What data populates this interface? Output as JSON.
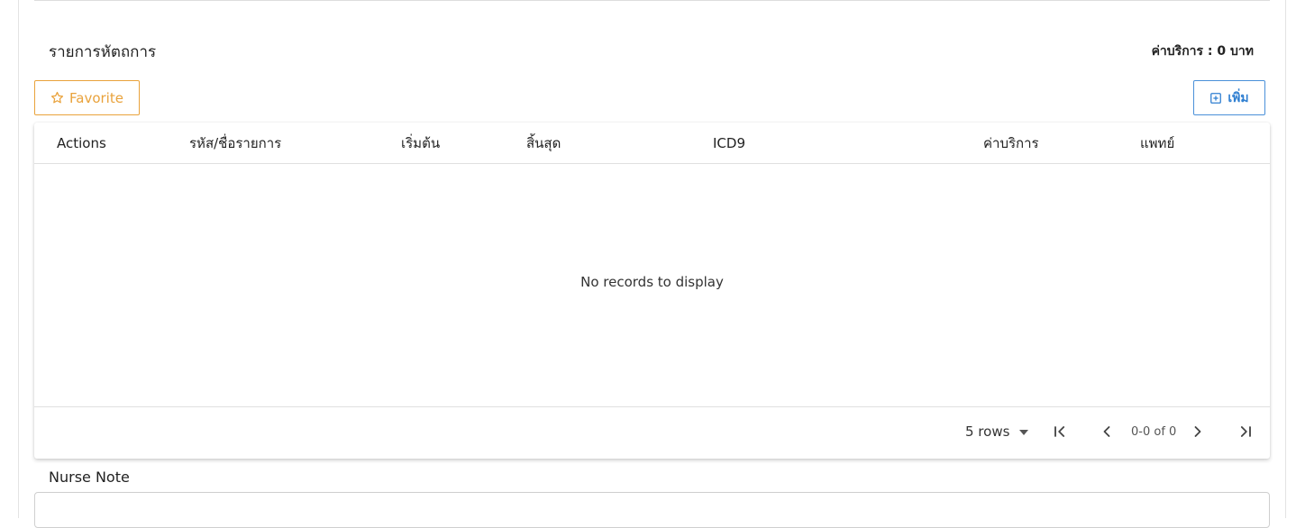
{
  "section": {
    "title": "รายการหัตถการ",
    "service_fee": "ค่าบริการ : 0 บาท"
  },
  "toolbar": {
    "favorite_label": "Favorite",
    "add_label": "เพิ่ม"
  },
  "table": {
    "columns": [
      "Actions",
      "รหัส/ชื่อรายการ",
      "เริ่มต้น",
      "สิ้นสุด",
      "ICD9",
      "ค่าบริการ",
      "แพทย์"
    ],
    "empty_message": "No records to display"
  },
  "pagination": {
    "rows_label": "5 rows",
    "range": "0-0 of 0"
  },
  "nurse_note": {
    "label": "Nurse Note",
    "value": ""
  },
  "colors": {
    "favorite_accent": "#e9a23b",
    "add_accent": "#2f7fd1"
  },
  "icons": {
    "favorite": "star-outline-icon",
    "add": "plus-square-icon",
    "rows_dropdown": "caret-down-icon",
    "first_page": "first-page-icon",
    "prev_page": "chevron-left-icon",
    "next_page": "chevron-right-icon",
    "last_page": "last-page-icon"
  }
}
